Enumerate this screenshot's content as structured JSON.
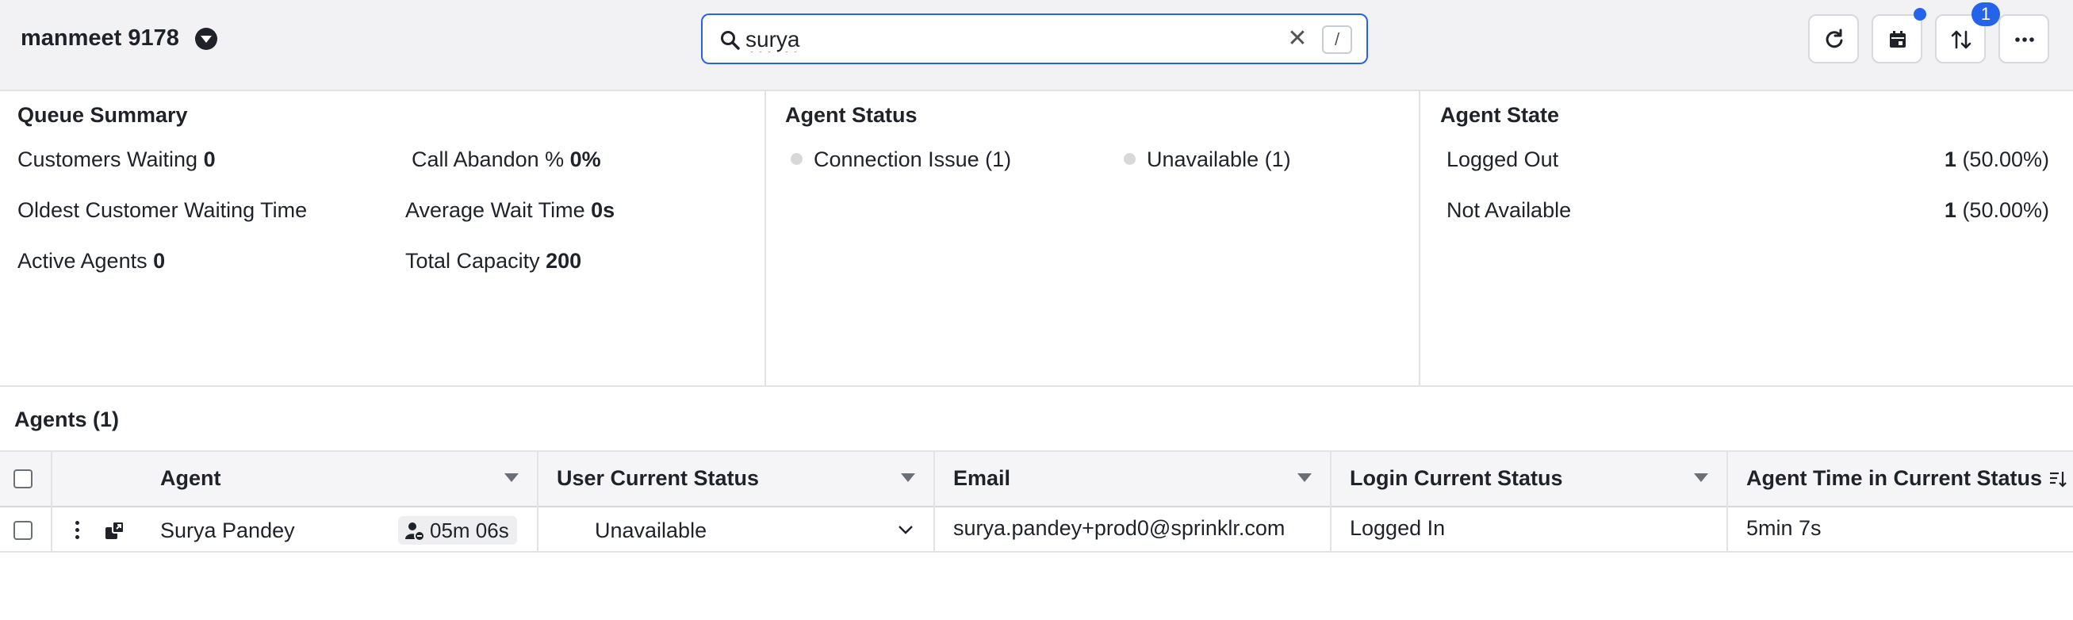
{
  "header": {
    "workspace_title": "manmeet 9178",
    "search": {
      "value": "surya",
      "shortcut": "/"
    },
    "sort_badge": "1"
  },
  "queue_summary": {
    "title": "Queue Summary",
    "customers_waiting_label": "Customers Waiting",
    "customers_waiting_value": "0",
    "call_abandon_label": "Call Abandon %",
    "call_abandon_value": "0%",
    "oldest_waiting_label": "Oldest Customer Waiting Time",
    "avg_wait_label": "Average Wait Time",
    "avg_wait_value": "0s",
    "active_agents_label": "Active Agents",
    "active_agents_value": "0",
    "total_capacity_label": "Total Capacity",
    "total_capacity_value": "200"
  },
  "agent_status": {
    "title": "Agent Status",
    "items": [
      {
        "label": "Connection Issue (1)"
      },
      {
        "label": "Unavailable (1)"
      }
    ]
  },
  "agent_state": {
    "title": "Agent State",
    "rows": [
      {
        "label": "Logged Out",
        "count": "1",
        "pct": "(50.00%)"
      },
      {
        "label": "Not Available",
        "count": "1",
        "pct": "(50.00%)"
      }
    ]
  },
  "agents_table": {
    "title": "Agents (1)",
    "columns": [
      "Agent",
      "User Current Status",
      "Email",
      "Login Current Status",
      "Agent Time in Current Status"
    ],
    "rows": [
      {
        "agent": "Surya Pandey",
        "timer": "05m 06s",
        "user_status": "Unavailable",
        "email": "surya.pandey+prod0@sprinklr.com",
        "login_status": "Logged In",
        "time_in_status": "5min 7s"
      }
    ]
  },
  "colors": {
    "accent": "#2563eb",
    "header_bg": "#f2f2f4",
    "status_dot": "#d8d8d8"
  }
}
